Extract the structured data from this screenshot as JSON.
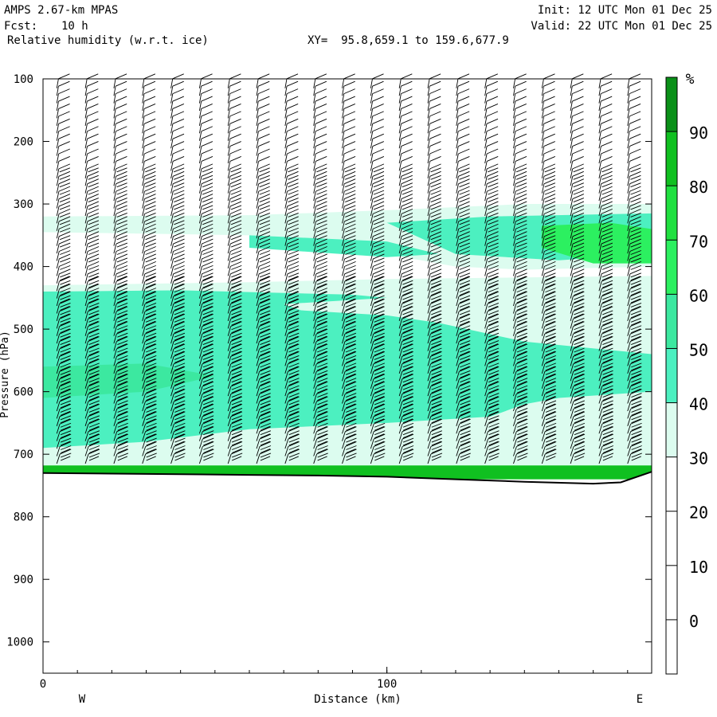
{
  "header": {
    "model": "AMPS 2.67-km MPAS",
    "fcst_label": "Fcst:",
    "fcst_value": "10 h",
    "field": "Relative humidity (w.r.t. ice)",
    "xy": "XY=  95.8,659.1 to 159.6,677.9",
    "init": "Init: 12 UTC Mon 01 Dec 25",
    "valid": "Valid: 22 UTC Mon 01 Dec 25"
  },
  "chart_data": {
    "type": "heatmap",
    "title": "Relative humidity (w.r.t. ice)",
    "xlabel": "Distance (km)",
    "ylabel": "Pressure (hPa)",
    "xlim": [
      0,
      177
    ],
    "ylim": [
      100,
      1050
    ],
    "y_reversed": true,
    "yticks": [
      100,
      200,
      300,
      400,
      500,
      600,
      700,
      800,
      900,
      1000
    ],
    "xticks": [
      0,
      100
    ],
    "x_end_labels": {
      "left": "W",
      "right": "E"
    },
    "colorbar": {
      "unit": "%",
      "ticks": [
        0,
        10,
        20,
        30,
        40,
        50,
        60,
        70,
        80,
        90
      ],
      "levels": [
        -10,
        0,
        10,
        20,
        30,
        40,
        50,
        60,
        70,
        80,
        90,
        100
      ],
      "colors": [
        "#ffffff",
        "#ffffff",
        "#ffffff",
        "#ffffff",
        "#dcfcef",
        "#4cf0c0",
        "#3ce8a0",
        "#2cf060",
        "#20e040",
        "#10c020",
        "#0a9018"
      ]
    },
    "terrain_pressure": {
      "x": [
        0,
        20,
        40,
        60,
        80,
        100,
        120,
        140,
        160,
        168,
        177
      ],
      "p": [
        730,
        731,
        732,
        733,
        734,
        736,
        740,
        744,
        747,
        745,
        728
      ]
    },
    "wind_barbs": "wind barbs plotted at each column and level",
    "rh_regions": [
      {
        "label": "RH 30-40 upper band",
        "x": [
          0,
          177
        ],
        "p": [
          315,
          345
        ]
      },
      {
        "label": "RH 40-50 mid layer",
        "x": [
          0,
          177
        ],
        "p": [
          430,
          700
        ]
      },
      {
        "label": "RH 60-70 core",
        "x": [
          145,
          177
        ],
        "p": [
          330,
          400
        ]
      }
    ]
  }
}
